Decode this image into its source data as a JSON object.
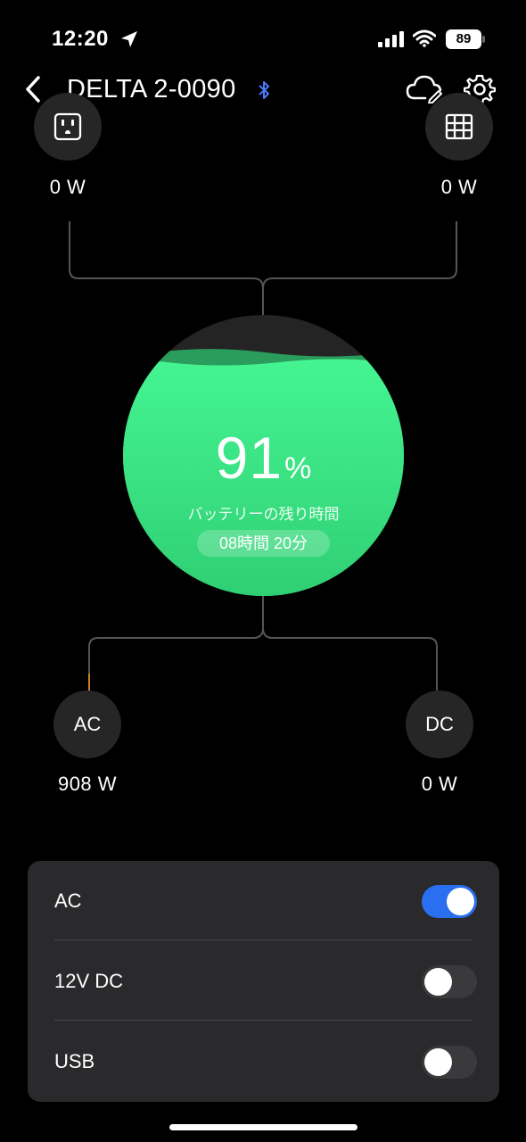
{
  "status_bar": {
    "time": "12:20",
    "battery": "89"
  },
  "header": {
    "title": "DELTA 2-0090"
  },
  "inputs": {
    "outlet_watts": "0 W",
    "grid_watts": "0 W"
  },
  "battery": {
    "percent_value": "91",
    "percent_sign": "%",
    "level": 0.91,
    "remaining_label": "バッテリーの残り時間",
    "remaining_time": "08時間 20分"
  },
  "outputs": {
    "ac_label": "AC",
    "ac_watts": "908 W",
    "dc_label": "DC",
    "dc_watts": "0 W"
  },
  "controls": [
    {
      "label": "AC",
      "on": true
    },
    {
      "label": "12V DC",
      "on": false
    },
    {
      "label": "USB",
      "on": false
    }
  ],
  "colors": {
    "accent_green": "#3ee88a",
    "toggle_on": "#2a6ff0",
    "bluetooth": "#4a7cff"
  }
}
